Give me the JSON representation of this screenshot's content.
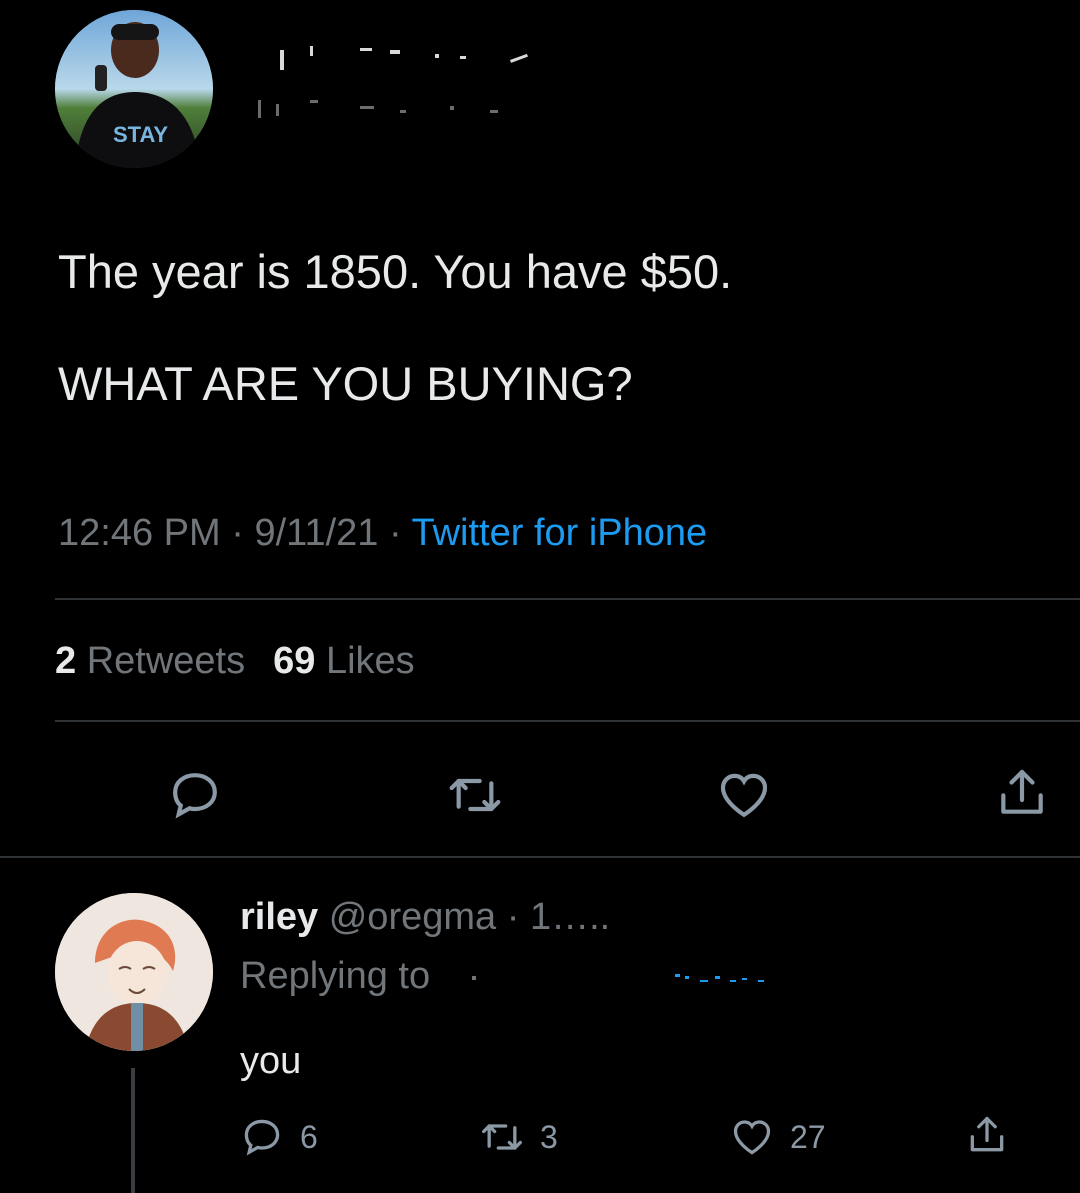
{
  "tweet": {
    "line1": "The year is 1850. You have $50.",
    "line2": "WHAT ARE YOU BUYING?",
    "time": "12:46 PM",
    "date": "9/11/21",
    "source": "Twitter for iPhone",
    "retweets_count": "2",
    "retweets_label": "Retweets",
    "likes_count": "69",
    "likes_label": "Likes",
    "avatar_shirt_text": "STAY"
  },
  "actions": {
    "reply_icon": "reply-icon",
    "retweet_icon": "retweet-icon",
    "like_icon": "heart-icon",
    "share_icon": "share-icon"
  },
  "reply": {
    "name": "riley",
    "handle": "@oregma",
    "time_partial": "1…..",
    "replying_to": "Replying to",
    "text": "you",
    "reply_count": "6",
    "retweet_count": "3",
    "like_count": "27"
  },
  "colors": {
    "background": "#000000",
    "text": "#e7e9ea",
    "secondary": "#71767b",
    "link": "#1d9bf0",
    "divider": "#2f3336"
  }
}
